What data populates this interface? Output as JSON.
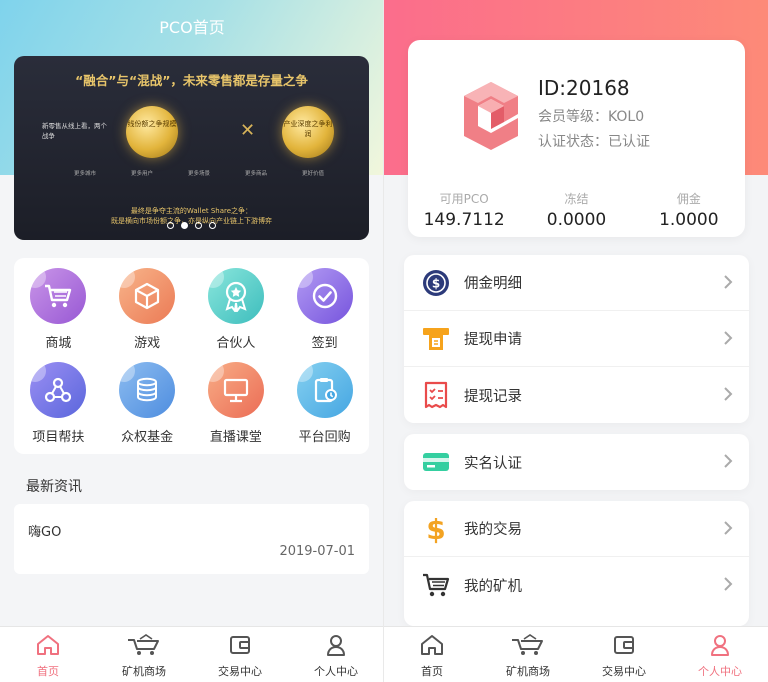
{
  "left": {
    "title": "PCO首页",
    "banner": {
      "headline": "“融合”与“混战”，未来零售都是存量之争",
      "side_text": "新零售从线上看，两个战争",
      "coin_left": "线份额之争规模",
      "coin_right": "产业深度之争利润",
      "steps": [
        "更多城市",
        "更多用户",
        "更多场景",
        "更多商品",
        "更好价值"
      ],
      "footer_line1": "最终是争夺主流的Wallet Share之争：",
      "footer_line2": "既是横向市场份额之争，亦是纵向产业链上下游博弈",
      "dots": 4,
      "active_dot": 1
    },
    "grid": [
      {
        "label": "商城",
        "icon": "cart-icon",
        "color1": "#c07de0",
        "color2": "#9b59d6"
      },
      {
        "label": "游戏",
        "icon": "box-icon",
        "color1": "#f6a97a",
        "color2": "#ee7f58"
      },
      {
        "label": "合伙人",
        "icon": "award-icon",
        "color1": "#7ee0d8",
        "color2": "#43c1c1"
      },
      {
        "label": "签到",
        "icon": "check-circle-icon",
        "color1": "#a98cf0",
        "color2": "#7c5be0"
      },
      {
        "label": "项目帮扶",
        "icon": "share-nodes-icon",
        "color1": "#8f86f2",
        "color2": "#5f6ce0"
      },
      {
        "label": "众权基金",
        "icon": "coins-icon",
        "color1": "#7fb2ee",
        "color2": "#5390e0"
      },
      {
        "label": "直播课堂",
        "icon": "monitor-icon",
        "color1": "#f6a07a",
        "color2": "#ee7058"
      },
      {
        "label": "平台回购",
        "icon": "clipboard-icon",
        "color1": "#7ac8ee",
        "color2": "#4aa9e3"
      }
    ],
    "news_heading": "最新资讯",
    "news": [
      {
        "title": "嗨GO",
        "date": "2019-07-01"
      }
    ],
    "tabs": [
      {
        "label": "首页",
        "icon": "home-icon",
        "active": true
      },
      {
        "label": "矿机商场",
        "icon": "cart-truck-icon",
        "active": false
      },
      {
        "label": "交易中心",
        "icon": "wallet-icon",
        "active": false
      },
      {
        "label": "个人中心",
        "icon": "person-icon",
        "active": false
      }
    ]
  },
  "right": {
    "profile": {
      "id": "ID:20168",
      "level": "会员等级：KOL0",
      "auth": "认证状态：已认证"
    },
    "stats": [
      {
        "label": "可用PCO",
        "value": "149.7112"
      },
      {
        "label": "冻结",
        "value": "0.0000"
      },
      {
        "label": "佣金",
        "value": "1.0000"
      }
    ],
    "menu1": [
      {
        "label": "佣金明细",
        "icon": "dollar-circle-icon"
      },
      {
        "label": "提现申请",
        "icon": "atm-icon"
      },
      {
        "label": "提现记录",
        "icon": "receipt-icon"
      }
    ],
    "menu2": [
      {
        "label": "实名认证",
        "icon": "id-card-icon"
      }
    ],
    "menu3": [
      {
        "label": "我的交易",
        "icon": "dollar-icon"
      },
      {
        "label": "我的矿机",
        "icon": "cart-icon"
      }
    ],
    "tabs": [
      {
        "label": "首页",
        "icon": "home-icon",
        "active": false
      },
      {
        "label": "矿机商场",
        "icon": "cart-truck-icon",
        "active": false
      },
      {
        "label": "交易中心",
        "icon": "wallet-icon",
        "active": false
      },
      {
        "label": "个人中心",
        "icon": "person-icon",
        "active": true
      }
    ]
  },
  "colors": {
    "accent": "#f0717f",
    "hero_right_from": "#fb6d8c",
    "hero_right_to": "#fd8a78",
    "hero_left_from": "#7fd3ec",
    "hero_left_to": "#f2f7dc"
  }
}
